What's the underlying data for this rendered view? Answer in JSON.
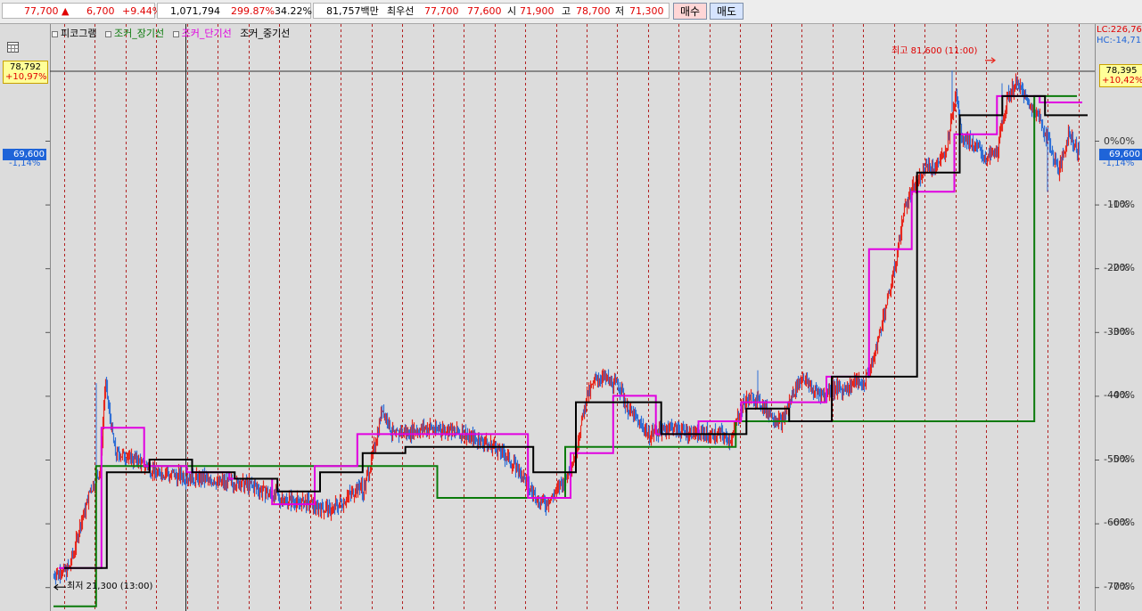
{
  "topbar": {
    "price": "77,700",
    "change_arrow": "▲",
    "change": "6,700",
    "change_pct": "+9.44%",
    "volume": "1,071,794",
    "volume_ratio": "299.87%",
    "turnover": "34.22%",
    "amount": "81,757백만",
    "best_label": "최우선",
    "best_ask": "77,700",
    "best_bid": "77,600",
    "open_label": "시",
    "open": "71,900",
    "high_label": "고",
    "high": "78,700",
    "low_label": "저",
    "low": "71,300",
    "buy_label": "매수",
    "sell_label": "매도"
  },
  "legend": {
    "item1": "피코그램",
    "item2": "조커_장기선",
    "item3": "조커_단기선",
    "item4": "조커_중기선"
  },
  "lc_hc": {
    "lc": "LC:226,76",
    "hc": "HC:-14,71"
  },
  "left_tags": {
    "high_price": "78,792",
    "high_pct": "+10,97%",
    "cur_price": "69,600",
    "cur_pct": "-1,14%"
  },
  "right_tags": {
    "high_price": "78,395",
    "high_pct": "+10,42%",
    "cur_price": "69,600",
    "cur_pct": "-1,14%"
  },
  "y_axis_labels": [
    "0%",
    "-10%",
    "-20%",
    "-30%",
    "-40%",
    "-50%",
    "-60%",
    "-70%"
  ],
  "annotations": {
    "max_label": "최고 81,600 (11:00)",
    "min_label": "최저 21,300 (13:00)"
  },
  "colors": {
    "up": "#e8261c",
    "down": "#2f6fd6",
    "long_line": "#0a7a0a",
    "short_line": "#e000e0",
    "mid_line": "#000000",
    "session_divider": "#b22222"
  },
  "chart_data": {
    "type": "line",
    "y_unit": "%",
    "ylim": [
      -70,
      10.97
    ],
    "yticks": [
      0,
      -10,
      -20,
      -30,
      -40,
      -50,
      -60,
      -70
    ],
    "grid": true,
    "series": [
      {
        "name": "조커_장기선",
        "values": [
          -75,
          -51,
          -51,
          -51,
          -51,
          -51,
          -51,
          -51,
          -51,
          -56,
          -56,
          -56,
          -48,
          -48,
          -48,
          -48,
          -44,
          -44,
          -44,
          -44,
          -44,
          -44,
          -44,
          7
        ]
      },
      {
        "name": "조커_단기선",
        "values": [
          -67,
          -45,
          -51,
          -52,
          -53,
          -57,
          -51,
          -46,
          -46,
          -46,
          -46,
          -56,
          -49,
          -40,
          -46,
          -44,
          -41,
          -41,
          -37,
          -17,
          -8,
          1,
          7,
          6
        ]
      },
      {
        "name": "조커_중기선",
        "values": [
          -67,
          -52,
          -50,
          -52,
          -53,
          -55,
          -52,
          -49,
          -48,
          -48,
          -48,
          -52,
          -41,
          -41,
          -46,
          -46,
          -42,
          -44,
          -37,
          -37,
          -5,
          4,
          7,
          4
        ]
      }
    ]
  }
}
